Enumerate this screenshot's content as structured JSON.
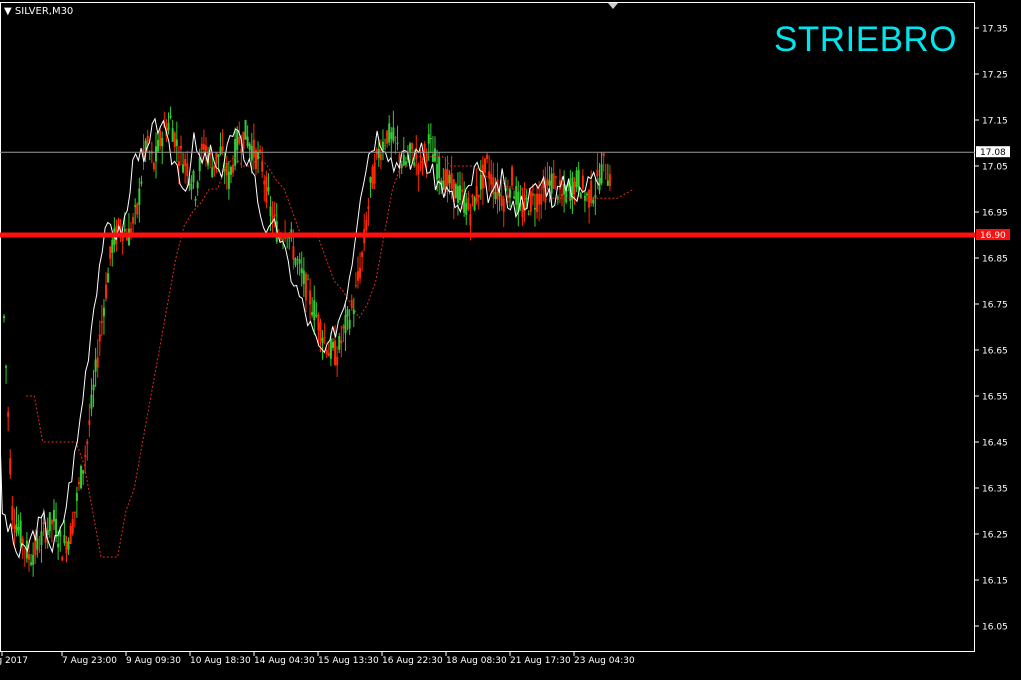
{
  "chart_header": {
    "symbol": "SILVER,M30",
    "overlay_title": "STRIEBRO"
  },
  "colors": {
    "background": "#000000",
    "foreground": "#FFFFFF",
    "bull_candle": "#32CD32",
    "bear_candle": "#FF2A00",
    "close_line": "#FFFFFF",
    "channel_line": "#E02A1E",
    "support_line": "#FF1010",
    "title": "#00E5EE"
  },
  "chart_data": {
    "type": "line",
    "title": "STRIEBRO",
    "symbol": "SILVER",
    "timeframe": "M30",
    "ylim": [
      16.0,
      17.4
    ],
    "y_ticks": [
      "17.35",
      "17.25",
      "17.15",
      "17.05",
      "16.95",
      "16.85",
      "16.75",
      "16.65",
      "16.55",
      "16.45",
      "16.35",
      "16.25",
      "16.15",
      "16.05"
    ],
    "x_ticks": [
      "4 Aug 2017",
      "7 Aug 23:00",
      "9 Aug 09:30",
      "10 Aug 18:30",
      "14 Aug 04:30",
      "15 Aug 13:30",
      "16 Aug 22:30",
      "18 Aug 08:30",
      "21 Aug 17:30",
      "23 Aug 04:30"
    ],
    "current_price": "17.08",
    "support_level": "16.90",
    "series": [
      {
        "kind": "close",
        "values": [
          16.72,
          16.3,
          16.25,
          16.2,
          16.22,
          16.26,
          16.28,
          16.22,
          16.25,
          16.35,
          16.45,
          16.6,
          16.75,
          16.88,
          16.92,
          16.9,
          16.95,
          17.1,
          17.05,
          17.12,
          17.15,
          17.08,
          17.05,
          17.0,
          17.1,
          17.05,
          17.08,
          17.02,
          17.1,
          17.12,
          17.08,
          17.05,
          16.95,
          16.9,
          16.92,
          16.85,
          16.8,
          16.75,
          16.7,
          16.65,
          16.64,
          16.7,
          16.75,
          16.85,
          17.0,
          17.08,
          17.12,
          17.1,
          17.05,
          17.08,
          17.05,
          17.1,
          17.05,
          17.02,
          17.0,
          16.98,
          16.95,
          17.0,
          17.05,
          17.0,
          16.98,
          17.02,
          16.95,
          16.97,
          16.98,
          17.0,
          17.02,
          16.98,
          17.0,
          17.02,
          16.98,
          17.0,
          17.05,
          17.02
        ]
      },
      {
        "kind": "channel",
        "values": [
          16.55,
          16.55,
          16.45,
          16.45,
          16.45,
          16.45,
          16.45,
          16.4,
          16.3,
          16.2,
          16.2,
          16.2,
          16.3,
          16.35,
          16.45,
          16.55,
          16.65,
          16.75,
          16.85,
          16.92,
          16.95,
          16.97,
          17.0,
          17.0,
          17.05,
          17.07,
          17.05,
          17.05,
          17.07,
          17.05,
          17.02,
          17.0,
          16.95,
          16.9,
          16.9,
          16.9,
          16.85,
          16.8,
          16.78,
          16.75,
          16.72,
          16.75,
          16.8,
          16.9,
          17.0,
          17.05,
          17.05,
          17.05,
          17.07,
          17.07,
          17.07,
          17.05,
          17.05,
          17.05,
          17.05,
          17.03,
          17.02,
          17.02,
          17.0,
          17.0,
          17.0,
          17.0,
          17.0,
          16.98,
          16.98,
          16.98,
          16.98,
          16.98,
          16.98,
          16.98,
          16.98,
          16.98,
          16.99,
          17.0
        ]
      }
    ]
  }
}
